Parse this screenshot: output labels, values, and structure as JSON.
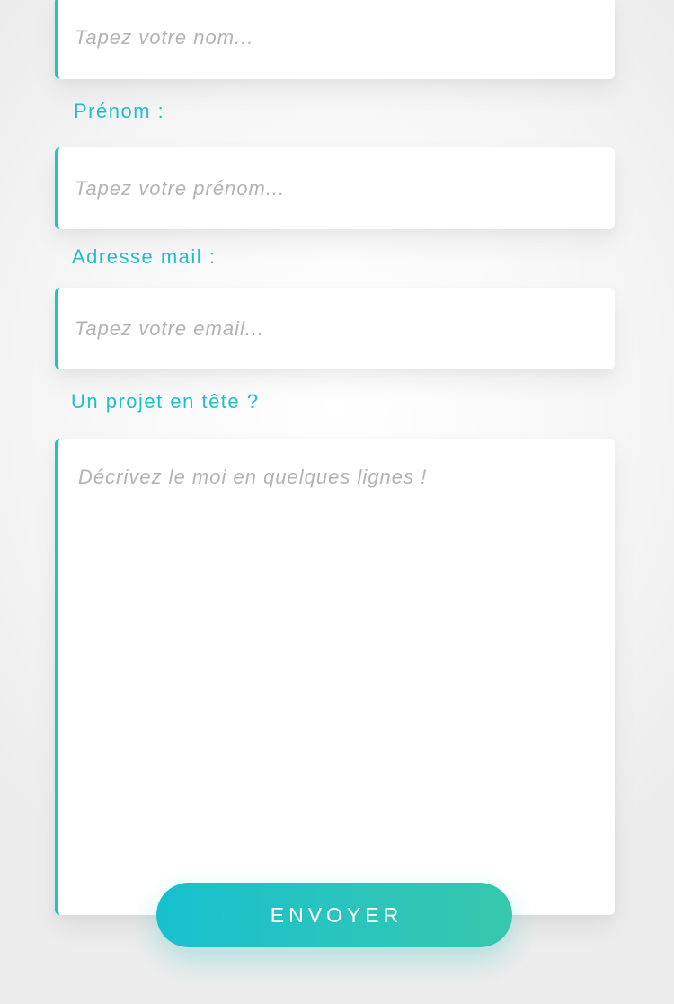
{
  "form": {
    "nom": {
      "placeholder": "Tapez votre nom..."
    },
    "prenom": {
      "label": "Prénom :",
      "placeholder": "Tapez votre prénom..."
    },
    "email": {
      "label": "Adresse mail :",
      "placeholder": "Tapez votre email..."
    },
    "projet": {
      "label": "Un projet en tête ?",
      "placeholder": "Décrivez le moi en quelques lignes !"
    },
    "submit_label": "ENVOYER"
  },
  "colors": {
    "accent": "#1fc2c8",
    "button_gradient_start": "#17c0cf",
    "button_gradient_end": "#36c8ad",
    "placeholder": "#b3b3b3"
  }
}
